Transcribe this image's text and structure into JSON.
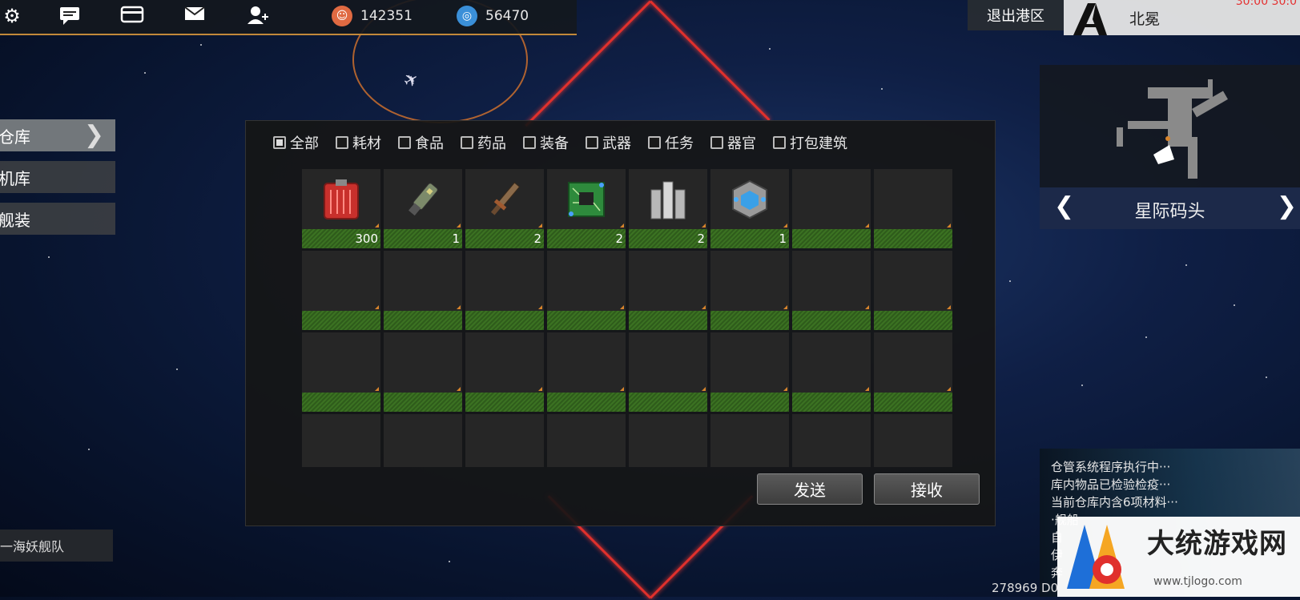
{
  "topbar": {
    "icons": [
      "settings-icon",
      "chat-icon",
      "card-icon",
      "mail-icon",
      "add-friend-icon"
    ],
    "resource_a": "142351",
    "resource_b": "56470"
  },
  "header_right": {
    "exit_label": "退出港区",
    "pilot_name": "北冕",
    "timer": "30:00 30:0"
  },
  "left_menu": {
    "items": [
      "仓库",
      "机库",
      "舰装"
    ],
    "fleet_label": "一海妖舰队"
  },
  "filters": [
    "全部",
    "耗材",
    "食品",
    "药品",
    "装备",
    "武器",
    "任务",
    "器官",
    "打包建筑"
  ],
  "inventory": {
    "slots": [
      {
        "icon": "red-container-icon",
        "qty": "300"
      },
      {
        "icon": "gun-part-icon",
        "qty": "1"
      },
      {
        "icon": "blade-weapon-icon",
        "qty": "2"
      },
      {
        "icon": "circuit-chip-icon",
        "qty": "2"
      },
      {
        "icon": "metal-plates-icon",
        "qty": "2"
      },
      {
        "icon": "crystal-cube-icon",
        "qty": "1"
      }
    ]
  },
  "buttons": {
    "send": "发送",
    "receive": "接收"
  },
  "minimap": {
    "location": "星际码头"
  },
  "log": {
    "lines": [
      "仓管系统程序执行中···",
      "库内物品已检验检疫···",
      "当前仓库内含6项材料···",
      "·舰船",
      "自",
      "伊",
      "奔"
    ]
  },
  "coords": "278969 D0",
  "watermark": {
    "text": "大统游戏网",
    "url": "www.tjlogo.com"
  },
  "colors": {
    "accent_orange": "#c2893a",
    "diamond_red": "#e0302c",
    "slot_bar_green": "#3b7222"
  }
}
